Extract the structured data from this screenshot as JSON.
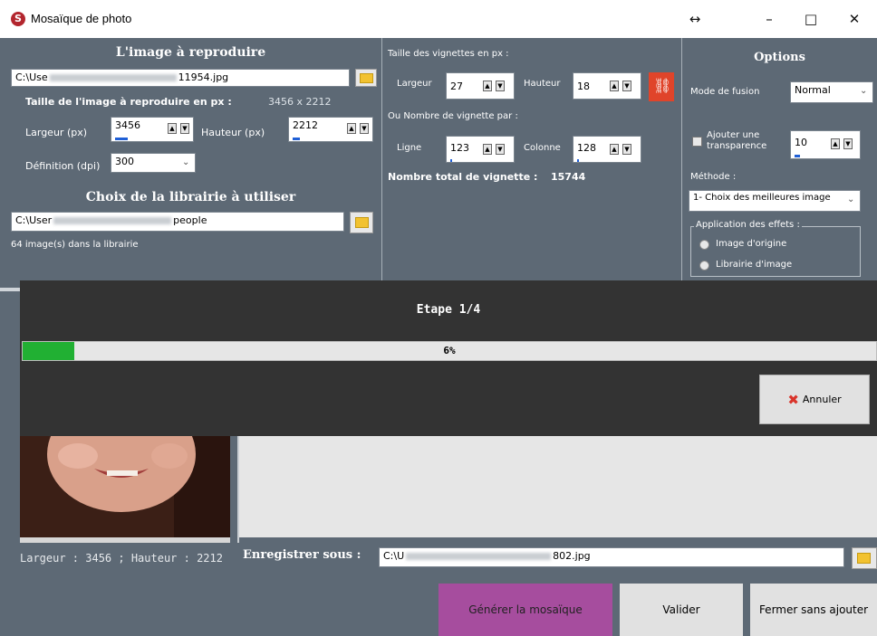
{
  "window": {
    "app_icon": "S",
    "title": "Mosaïque de photo",
    "resize_glyph": "↔",
    "minimize": "–",
    "maximize": "□",
    "close": "✕"
  },
  "source": {
    "header": "L'image à reproduire",
    "path_prefix": "C:\\Use",
    "path_suffix": "11954.jpg",
    "size_label": "Taille de l'image à reproduire en px :",
    "size_value": "3456 x 2212",
    "width_label": "Largeur (px)",
    "width_value": "3456",
    "height_label": "Hauteur (px)",
    "height_value": "2212",
    "dpi_label": "Définition (dpi)",
    "dpi_value": "300"
  },
  "library": {
    "header": "Choix de la librairie à utiliser",
    "path_prefix": "C:\\User",
    "path_suffix": "people",
    "count_text": "64 image(s) dans la librairie"
  },
  "tiles": {
    "size_label": "Taille des vignettes en px :",
    "width_label": "Largeur",
    "width_value": "27",
    "height_label": "Hauteur",
    "height_value": "18",
    "count_label": "Ou Nombre de vignette par :",
    "row_label": "Ligne",
    "row_value": "123",
    "col_label": "Colonne",
    "col_value": "128",
    "total_label": "Nombre total de vignette :",
    "total_value": "15744"
  },
  "options": {
    "header": "Options",
    "blend_label": "Mode de fusion",
    "blend_value": "Normal",
    "transparency_label_1": "Ajouter une",
    "transparency_label_2": "transparence",
    "transparency_value": "10",
    "method_label": "Méthode :",
    "method_value": "1- Choix des meilleures image",
    "effects_label": "Application des effets :",
    "radio_origin": "Image d'origine",
    "radio_library": "Librairie d'image"
  },
  "progress": {
    "step": "Etape 1/4",
    "percent_text": "6%",
    "percent": 6,
    "cancel_label": "Annuler"
  },
  "preview": {
    "dimensions_text": "Largeur : 3456 ; Hauteur : 2212"
  },
  "save": {
    "label": "Enregistrer sous :",
    "path_prefix": "C:\\U",
    "path_suffix": "802.jpg"
  },
  "buttons": {
    "generate": "Générer la mosaïque",
    "validate": "Valider",
    "close_no_add": "Fermer sans ajouter"
  },
  "colors": {
    "panel": "#5d6975",
    "overlay": "#333333",
    "progress_fill": "#21b033",
    "generate_button": "#a64d9e",
    "link_button": "#e0442a"
  }
}
